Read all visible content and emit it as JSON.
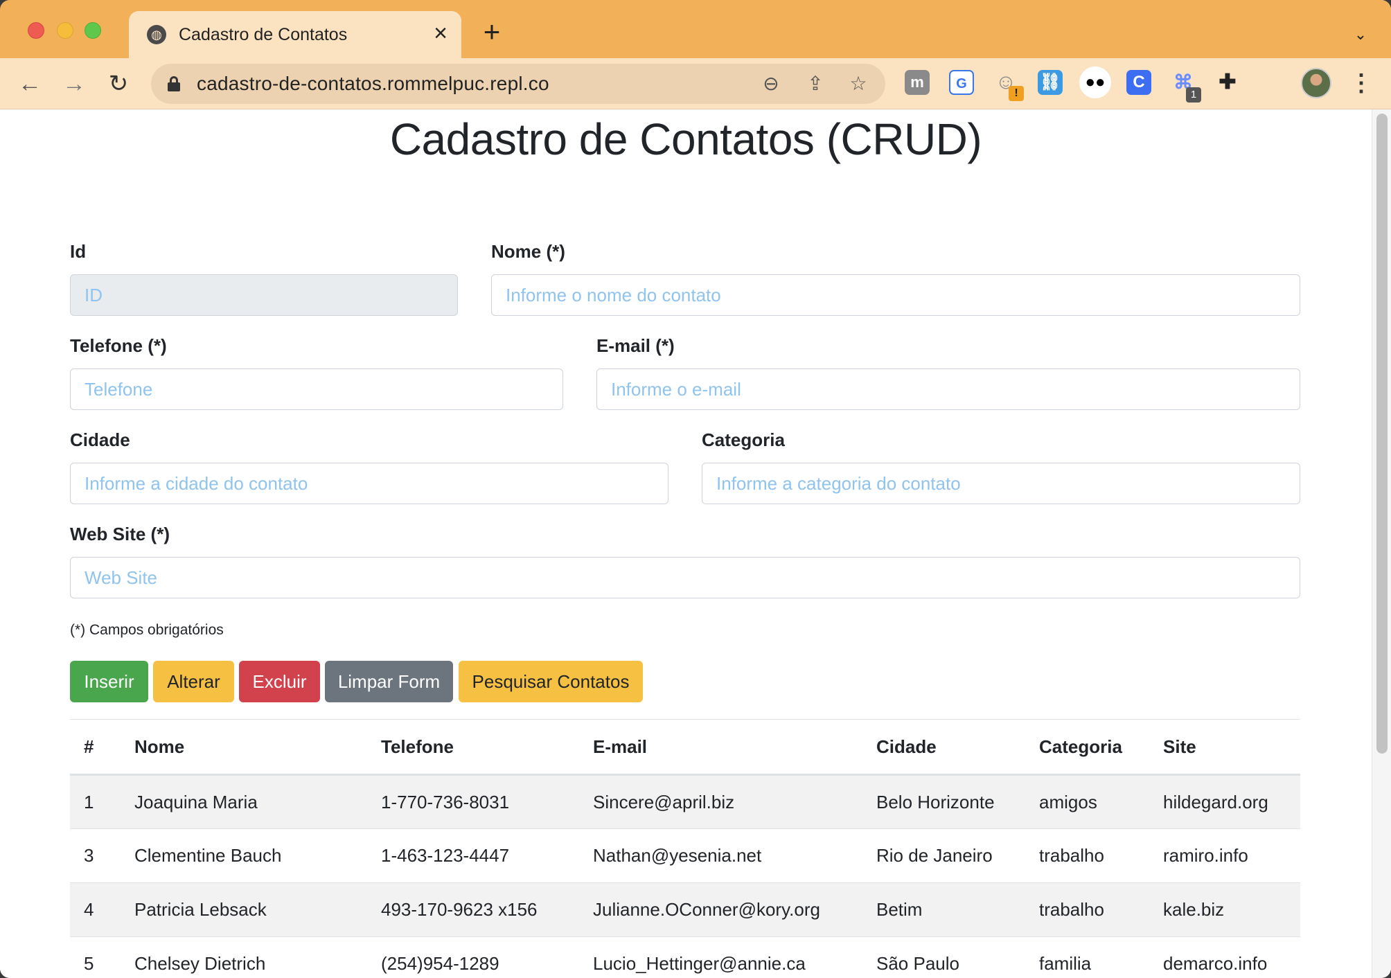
{
  "browser": {
    "tab_title": "Cadastro de Contatos",
    "url": "cadastro-de-contatos.rommelpuc.repl.co",
    "extension_badges": {
      "ghost": "!",
      "command": "1"
    },
    "extension_letters": {
      "m": "m",
      "g": "G",
      "c": "C"
    }
  },
  "page": {
    "title": "Cadastro de Contatos (CRUD)"
  },
  "form": {
    "id": {
      "label": "Id",
      "placeholder": "ID"
    },
    "nome": {
      "label": "Nome (*)",
      "placeholder": "Informe o nome do contato"
    },
    "telefone": {
      "label": "Telefone (*)",
      "placeholder": "Telefone"
    },
    "email": {
      "label": "E-mail (*)",
      "placeholder": "Informe o e-mail"
    },
    "cidade": {
      "label": "Cidade",
      "placeholder": "Informe a cidade do contato"
    },
    "categoria": {
      "label": "Categoria",
      "placeholder": "Informe a categoria do contato"
    },
    "website": {
      "label": "Web Site (*)",
      "placeholder": "Web Site"
    },
    "required_note": "(*) Campos obrigatórios"
  },
  "buttons": {
    "insert": "Inserir",
    "alter": "Alterar",
    "delete": "Excluir",
    "clear": "Limpar Form",
    "search": "Pesquisar Contatos"
  },
  "table": {
    "headers": [
      "#",
      "Nome",
      "Telefone",
      "E-mail",
      "Cidade",
      "Categoria",
      "Site"
    ],
    "rows": [
      [
        "1",
        "Joaquina Maria",
        "1-770-736-8031",
        "Sincere@april.biz",
        "Belo Horizonte",
        "amigos",
        "hildegard.org"
      ],
      [
        "3",
        "Clementine Bauch",
        "1-463-123-4447",
        "Nathan@yesenia.net",
        "Rio de Janeiro",
        "trabalho",
        "ramiro.info"
      ],
      [
        "4",
        "Patricia Lebsack",
        "493-170-9623 x156",
        "Julianne.OConner@kory.org",
        "Betim",
        "trabalho",
        "kale.biz"
      ],
      [
        "5",
        "Chelsey Dietrich",
        "(254)954-1289",
        "Lucio_Hettinger@annie.ca",
        "São Paulo",
        "familia",
        "demarco.info"
      ]
    ]
  },
  "colors": {
    "titlebar": "#f2b158",
    "toolbar": "#fbe3c2",
    "btn_success": "#4aa64c",
    "btn_warning": "#f6c043",
    "btn_danger": "#d2424d",
    "btn_secondary": "#6c757d",
    "placeholder": "#8fc3f0"
  }
}
